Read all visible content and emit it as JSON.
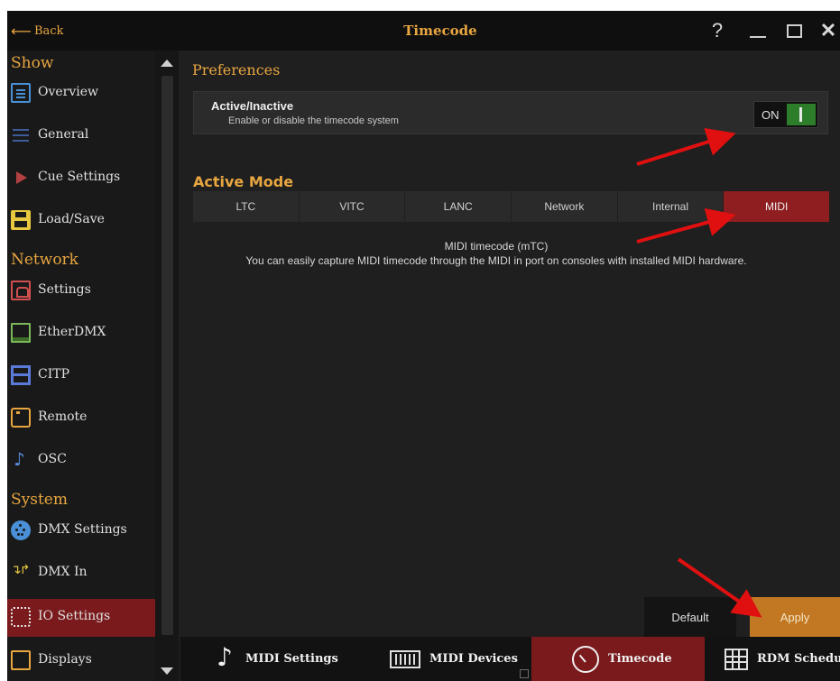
{
  "titlebar": {
    "back_label": "Back",
    "title": "Timecode",
    "help_label": "?",
    "close_label": "✕"
  },
  "sidebar": {
    "sections": [
      {
        "label": "Show",
        "items": [
          {
            "label": "Overview",
            "icon": "document-icon"
          },
          {
            "label": "General",
            "icon": "list-icon"
          },
          {
            "label": "Cue Settings",
            "icon": "play-triangle-icon"
          },
          {
            "label": "Load/Save",
            "icon": "save-icon"
          }
        ]
      },
      {
        "label": "Network",
        "items": [
          {
            "label": "Settings",
            "icon": "network-icon"
          },
          {
            "label": "EtherDMX",
            "icon": "etherdmx-icon"
          },
          {
            "label": "CITP",
            "icon": "citp-icon"
          },
          {
            "label": "Remote",
            "icon": "remote-icon"
          },
          {
            "label": "OSC",
            "icon": "osc-note-icon"
          }
        ]
      },
      {
        "label": "System",
        "items": [
          {
            "label": "DMX Settings",
            "icon": "dmx-connector-icon"
          },
          {
            "label": "DMX In",
            "icon": "dmx-in-icon"
          },
          {
            "label": "IO Settings",
            "icon": "io-settings-icon",
            "active": true
          },
          {
            "label": "Displays",
            "icon": "display-icon"
          }
        ]
      }
    ]
  },
  "preferences": {
    "title": "Preferences",
    "active_toggle": {
      "title": "Active/Inactive",
      "subtitle": "Enable or disable the timecode system",
      "state_label": "ON",
      "value": true
    }
  },
  "active_mode": {
    "title": "Active Mode",
    "modes": [
      "LTC",
      "VITC",
      "LANC",
      "Network",
      "Internal",
      "MIDI"
    ],
    "selected": "MIDI",
    "description_title": "MIDI timecode (mTC)",
    "description_text": "You can easily capture MIDI timecode through the MIDI in port on consoles with installed MIDI hardware."
  },
  "actions": {
    "default_label": "Default",
    "apply_label": "Apply"
  },
  "bottom_tabs": [
    {
      "label": "MIDI Settings",
      "icon": "music-note-icon"
    },
    {
      "label": "MIDI Devices",
      "icon": "keyboard-icon"
    },
    {
      "label": "Timecode",
      "icon": "stopwatch-icon",
      "active": true
    },
    {
      "label": "RDM Schedulin",
      "icon": "schedule-grid-icon"
    }
  ],
  "colors": {
    "accent": "#e8a640",
    "selected": "#8e1e20",
    "apply": "#c27822",
    "toggle_on": "#2e7d2a",
    "annotation_arrow": "#e01010"
  }
}
